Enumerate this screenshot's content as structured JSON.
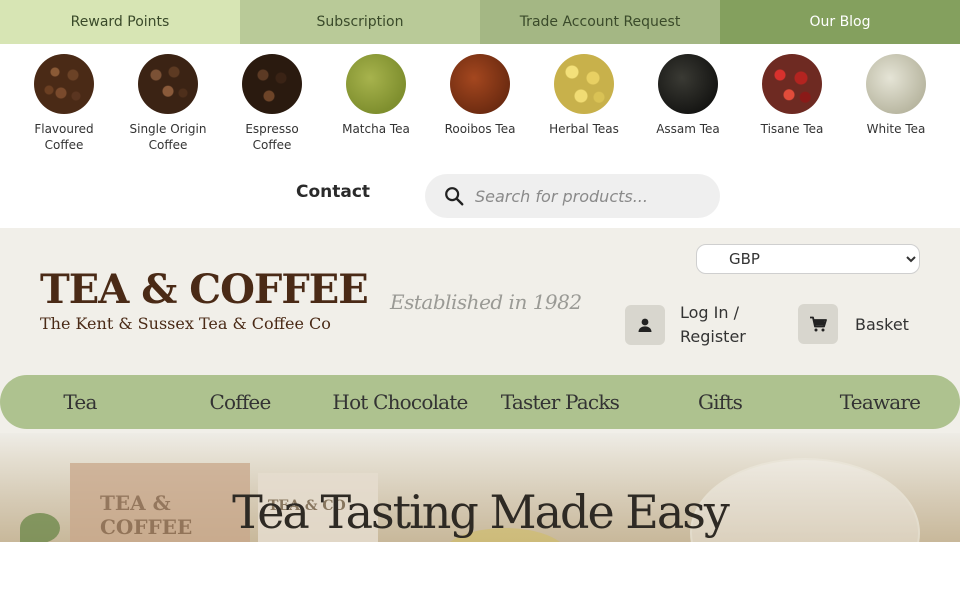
{
  "topbar": [
    {
      "label": "Reward Points"
    },
    {
      "label": "Subscription"
    },
    {
      "label": "Trade Account Request"
    },
    {
      "label": "Our Blog"
    }
  ],
  "categories": [
    {
      "label": "Flavoured\nCoffee",
      "icon": "coffee-beans"
    },
    {
      "label": "Single Origin\nCoffee",
      "icon": "coffee-beans"
    },
    {
      "label": "Espresso\nCoffee",
      "icon": "coffee-beans"
    },
    {
      "label": "Matcha Tea",
      "icon": "matcha-powder"
    },
    {
      "label": "Rooibos Tea",
      "icon": "rooibos-leaves"
    },
    {
      "label": "Herbal Teas",
      "icon": "chamomile-flowers"
    },
    {
      "label": "Assam Tea",
      "icon": "black-tea-leaves"
    },
    {
      "label": "Tisane Tea",
      "icon": "fruit-tisane"
    },
    {
      "label": "White Tea",
      "icon": "white-tea-leaves"
    }
  ],
  "search": {
    "contact_label": "Contact",
    "placeholder": "Search for products..."
  },
  "header": {
    "logo_main": "TEA & COFFEE",
    "logo_sub": "The Kent & Sussex Tea & Coffee Co",
    "tagline": "Established in 1982",
    "currency": "GBP",
    "login_label": "Log In /\nRegister",
    "basket_label": "Basket"
  },
  "nav": [
    {
      "label": "Tea"
    },
    {
      "label": "Coffee"
    },
    {
      "label": "Hot Chocolate"
    },
    {
      "label": "Taster Packs"
    },
    {
      "label": "Gifts"
    },
    {
      "label": "Teaware"
    }
  ],
  "hero": {
    "headline": "Tea Tasting Made Easy",
    "pack1_text": "TEA & COFFEE",
    "pack2_text": "TEA & CO"
  },
  "colors": {
    "accent": "#aec28f",
    "header_bg": "#f1efe9",
    "logo_brown": "#4a2a16"
  }
}
